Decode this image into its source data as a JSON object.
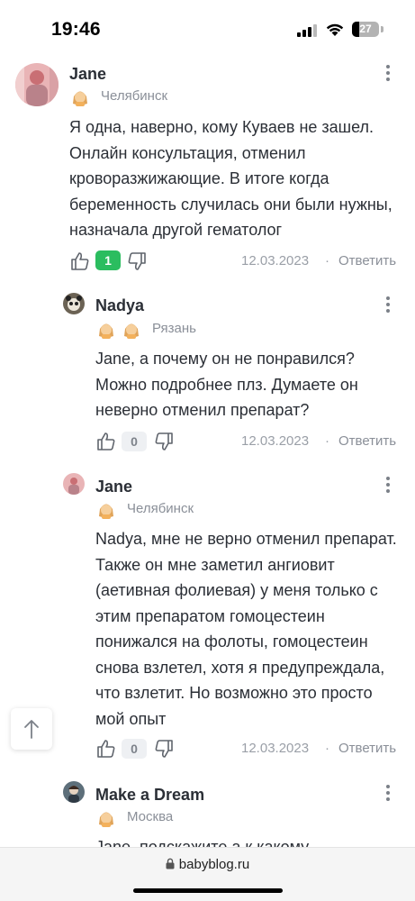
{
  "status_bar": {
    "time": "19:46",
    "battery": "27"
  },
  "comments": [
    {
      "author": "Jane",
      "city": "Челябинск",
      "badges": 1,
      "text": "Я одна, наверно, кому Куваев не зашел. Онлайн консультация, отменил кроворазжижающие. В итоге когда беременность случилась они были нужны, назначала другой гематолог",
      "rating": "1",
      "date": "12.03.2023",
      "reply": "Ответить"
    },
    {
      "author": "Nadya",
      "city": "Рязань",
      "badges": 2,
      "text": "Jane, а почему он не понравился? Можно подробнее плз. Думаете он неверно отменил препарат?",
      "rating": "0",
      "date": "12.03.2023",
      "reply": "Ответить"
    },
    {
      "author": "Jane",
      "city": "Челябинск",
      "badges": 1,
      "text": "Nadya, мне не верно отменил препарат. Также он мне заметил ангиовит (аетивная фолиевая) у меня только с этим препаратом гомоцестеин понижался на фолоты, гомоцестеин снова взлетел, хотя я предупреждала, что взлетит. Но возможно это просто мой опыт",
      "rating": "0",
      "date": "12.03.2023",
      "reply": "Ответить"
    },
    {
      "author": "Make a Dream",
      "city": "Москва",
      "badges": 1,
      "text": "Jane, подскажите а к какому"
    }
  ],
  "url_bar": {
    "domain": "babyblog.ru"
  },
  "colors": {
    "rating_positive": "#2bbd5f",
    "text": "#2b2f36",
    "muted": "#8a8f98"
  },
  "icons": [
    "thumbs-up-icon",
    "thumbs-down-icon",
    "more-icon",
    "arrow-up-icon",
    "lock-icon",
    "baby-badge-icon"
  ]
}
